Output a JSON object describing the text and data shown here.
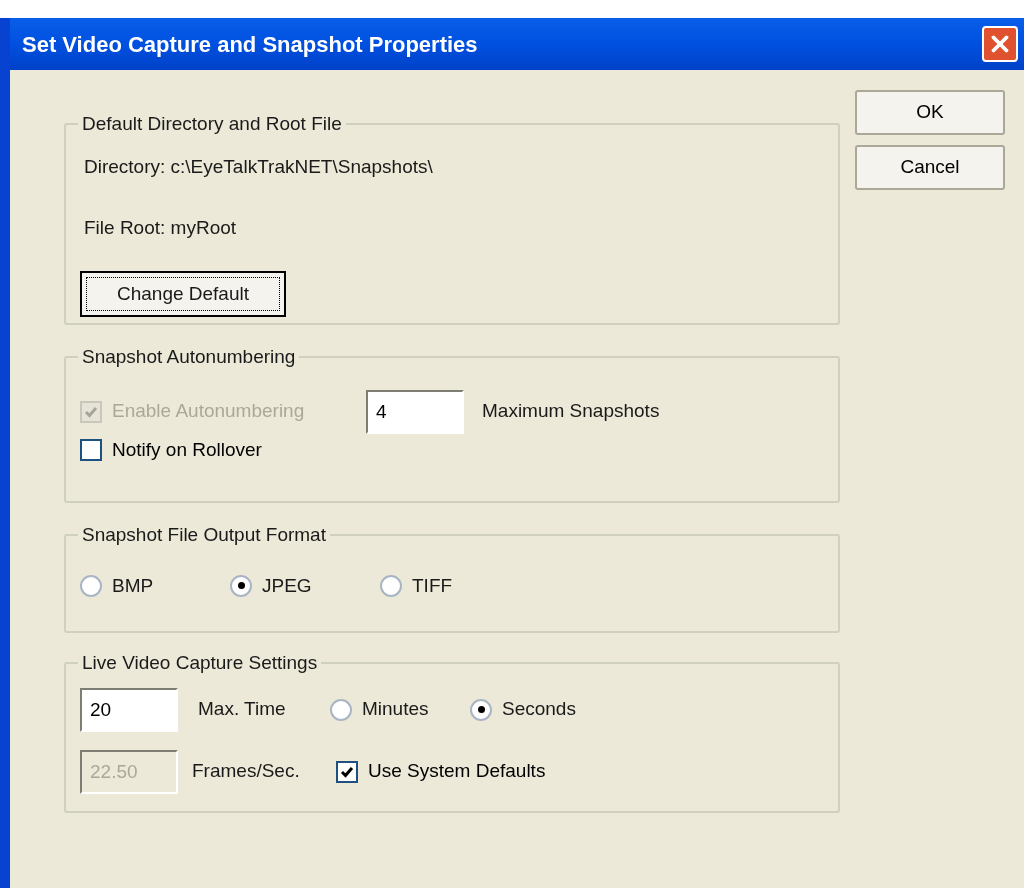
{
  "window": {
    "title": "Set Video Capture and Snapshot Properties"
  },
  "buttons": [
    {
      "label": "OK"
    },
    {
      "label": "Cancel"
    }
  ],
  "directory_group": {
    "title": "Default Directory and Root File",
    "directory": "Directory: c:\\EyeTalkTrakNET\\Snapshots\\",
    "file_root": "File Root: myRoot",
    "button": {
      "label": "Change Default",
      "focused": true
    }
  },
  "autonumbering_group": {
    "title": "Snapshot Autonumbering",
    "enable": {
      "label": "Enable Autonumbering",
      "checked": true,
      "disabled": true
    },
    "max_snapshots": {
      "value": "4",
      "label": "Maximum Snapshots",
      "disabled": false
    },
    "notify": {
      "label": "Notify on Rollover",
      "checked": false,
      "disabled": false
    }
  },
  "format_group": {
    "title": "Snapshot File Output Format",
    "options": [
      {
        "label": "BMP",
        "selected": false
      },
      {
        "label": "JPEG",
        "selected": true
      },
      {
        "label": "TIFF",
        "selected": false
      }
    ]
  },
  "live_group": {
    "title": "Live Video Capture Settings",
    "max_time": {
      "value": "20",
      "label": "Max. Time",
      "disabled": false
    },
    "units": [
      {
        "label": "Minutes",
        "selected": false
      },
      {
        "label": "Seconds",
        "selected": true
      }
    ],
    "frames": {
      "value": "22.50",
      "label": "Frames/Sec.",
      "disabled": true
    },
    "system_defaults": {
      "label": "Use System Defaults",
      "checked": true,
      "disabled": false
    }
  }
}
